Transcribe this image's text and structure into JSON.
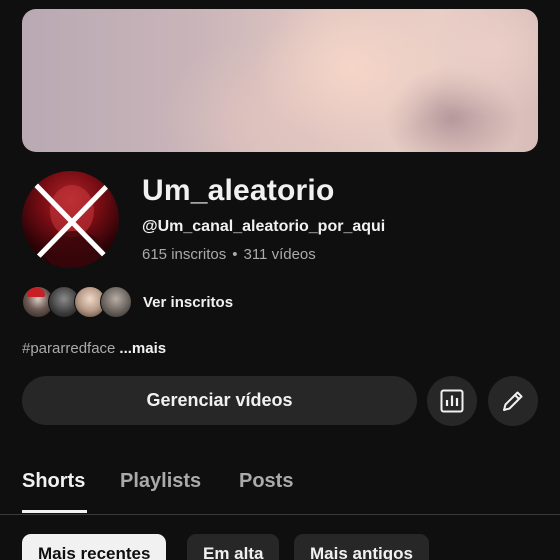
{
  "channel": {
    "name": "Um_aleatorio",
    "handle": "@Um_canal_aleatorio_por_aqui",
    "subscribers": "615 inscritos",
    "separator": "•",
    "videos": "311 vídeos",
    "see_subscribers": "Ver inscritos",
    "description": "#pararredface",
    "more": "...mais"
  },
  "actions": {
    "manage_videos": "Gerenciar vídeos",
    "analytics_icon": "bar-chart-icon",
    "edit_icon": "pencil-icon"
  },
  "tabs": [
    {
      "label": "Shorts",
      "active": true
    },
    {
      "label": "Playlists",
      "active": false
    },
    {
      "label": "Posts",
      "active": false
    }
  ],
  "filters": [
    {
      "label": "Mais recentes",
      "selected": true
    },
    {
      "label": "Em alta",
      "selected": false
    },
    {
      "label": "Mais antigos",
      "selected": false
    }
  ],
  "colors": {
    "background": "#0f0f0f",
    "surface": "#272727",
    "text_primary": "#f1f1f1",
    "text_secondary": "#aaaaaa"
  }
}
